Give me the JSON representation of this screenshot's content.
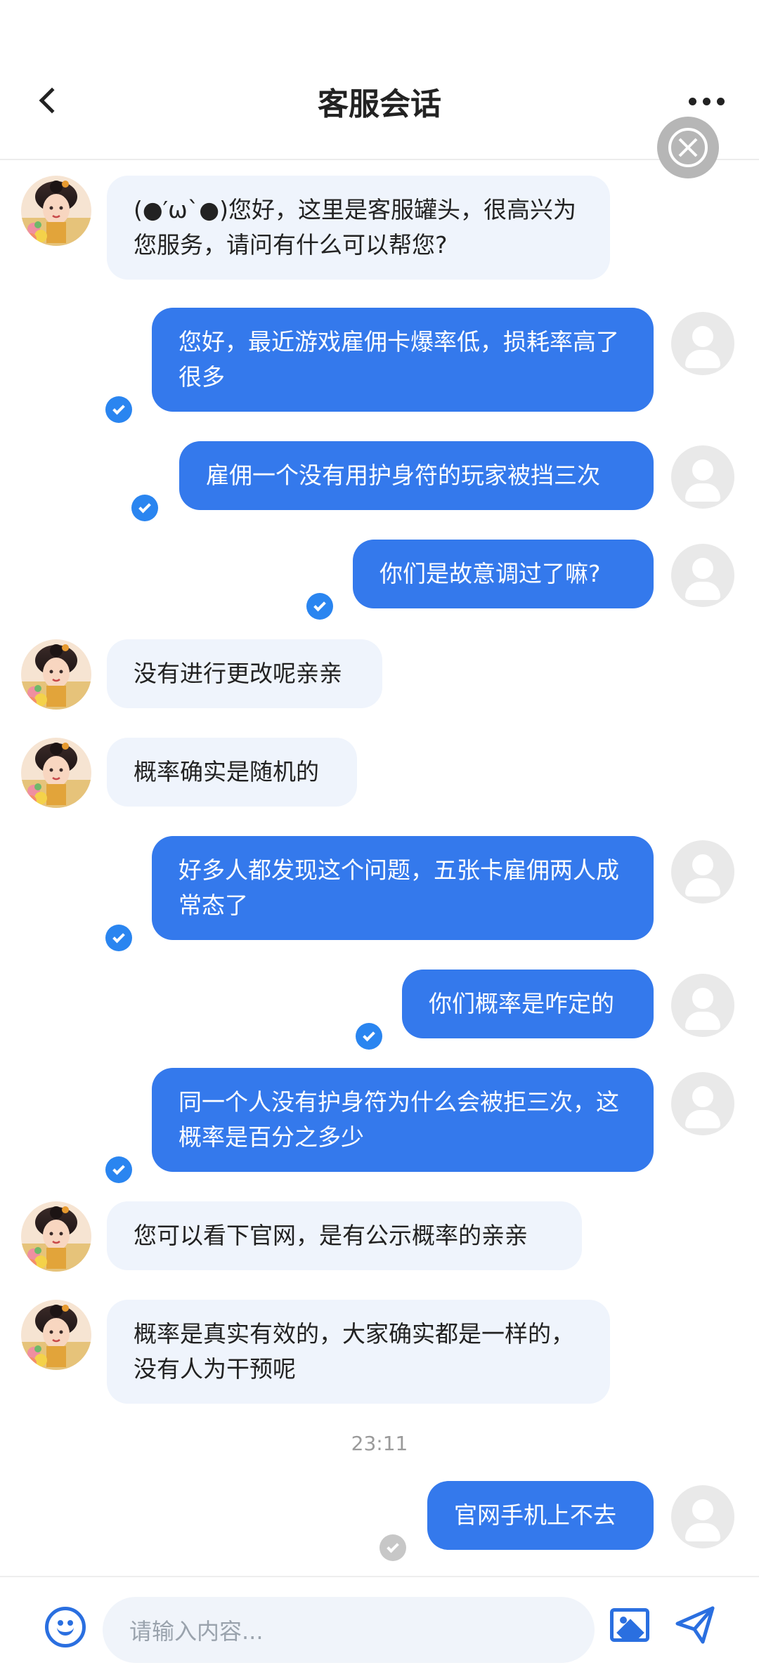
{
  "header": {
    "title": "客服会话"
  },
  "messages": {
    "m1": "(●′ω`●)您好，这里是客服罐头，很高兴为您服务，请问有什么可以帮您?",
    "m2": "您好，最近游戏雇佣卡爆率低，损耗率高了很多",
    "m3": "雇佣一个没有用护身符的玩家被挡三次",
    "m4": "你们是故意调过了嘛?",
    "m5": "没有进行更改呢亲亲",
    "m6": "概率确实是随机的",
    "m7": "好多人都发现这个问题，五张卡雇佣两人成常态了",
    "m8": "你们概率是咋定的",
    "m9": "同一个人没有护身符为什么会被拒三次，这概率是百分之多少",
    "m10": "您可以看下官网，是有公示概率的亲亲",
    "m11": " 概率是真实有效的，大家确实都是一样的，没有人为干预呢",
    "m12": "官网手机上不去"
  },
  "timestamp": "23:11",
  "composer": {
    "placeholder": "请输入内容..."
  },
  "icons": {
    "back": "chevron-left-icon",
    "more": "more-dots-icon",
    "close": "close-circle-icon",
    "emoji": "smiley-icon",
    "image": "image-icon",
    "send": "paper-plane-icon",
    "read": "check-circle-icon"
  },
  "colors": {
    "accent": "#3479ec",
    "incoming_bubble": "#eff4fc",
    "read_tick": "#2a85f0"
  }
}
